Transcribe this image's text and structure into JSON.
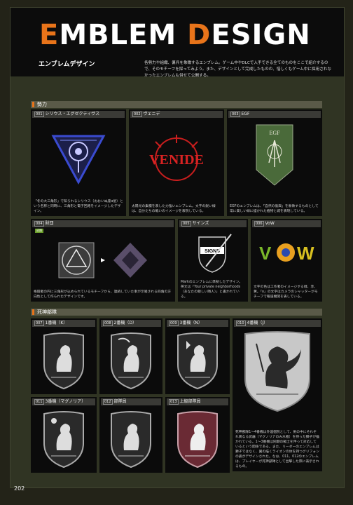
{
  "header": {
    "title_first": "E",
    "title_mid": "MBLEM ",
    "title_accent2": "D",
    "title_end": "ESIGN",
    "subtitle": "エンブレムデザイン",
    "intro": "各勢力や組織、傭兵を象徴するエンブレム。ゲーム中やDLCで入手できる全てのものをここで紹介するので、そのモチーフを探ってみよう。また、デザインとして完成したものの、惜しくもゲーム中に採用されなかったエンブレムも併せて公開する。"
  },
  "sections": {
    "factions": "勢力",
    "reapers": "死神部隊"
  },
  "faction_cards": [
    {
      "num": "001",
      "name": "シリウス・エグゼクティヴス",
      "desc": "「冬の大三角形」で知られるシリウス（おおいぬ座α星）という名称と同時に、三角形と電子回路をイメージしたデザイン。"
    },
    {
      "num": "002",
      "name": "ヴェニデ",
      "desc": "太陽光の集積を表した力強いエンブレム。文字の鋭い線は、自分たちの戦いのイメージを表現している。"
    },
    {
      "num": "003",
      "name": "EGF",
      "desc": "EGFのエンブレムは、「自然の復興」を象徴するものとして常に美しい緑に描かれた植物と城を表現している。",
      "inner_text": "EGF"
    },
    {
      "num": "004",
      "name": "財団",
      "badge": "初期",
      "desc": "格闘者の円に三角形が込められているモチーフから、連続していた事が示唆される四角の方向性として作られたデザインです。"
    },
    {
      "num": "005",
      "name": "サインズ",
      "inner_text": "SIGNS",
      "desc": "Markのエンブレムに準拠したデザイン。英文は「Your private neighborhoods（あなたの親しい隣人）」と書かれている。"
    },
    {
      "num": "006",
      "name": "VoW",
      "inner_text": "VOW",
      "desc": "文字の色は工作者のイメージする緑、赤、黄。「o」の文字はカメラのシャッターがモチーフで報道機関を表している。"
    }
  ],
  "reaper_cards": [
    {
      "num": "007",
      "name": "1番機（K）"
    },
    {
      "num": "008",
      "name": "2番機（D）"
    },
    {
      "num": "009",
      "name": "3番機（N）"
    },
    {
      "num": "010",
      "name": "4番機（J）",
      "desc": "死神部隊1〜4番機は外連個別として、剣の中にそれぞれ異なる武器（マグノリアのみ水瓶）を持った獅子が描かれている。1〜3番機は同期の戦士を伴って対応しているという関係である。また、リーダーのエンブレムは獅子ではなく、翼の描くライオンの体を持つグリフォンの姿がデザインされた。なお、011、012のエンブレムは、プレイヤーが死神部隊として出撃した際に表示されるもの。"
    },
    {
      "num": "011",
      "name": "3番機（マグノリア）"
    },
    {
      "num": "012",
      "name": "部隊員"
    },
    {
      "num": "013",
      "name": "上級部隊員"
    }
  ],
  "page_number": "202",
  "colors": {
    "accent": "#e8741a",
    "badge": "#6a9d2a",
    "venide_red": "#c81e1e",
    "egf_green": "#4a6a3a",
    "sirius_blue": "#2a3aa8"
  }
}
